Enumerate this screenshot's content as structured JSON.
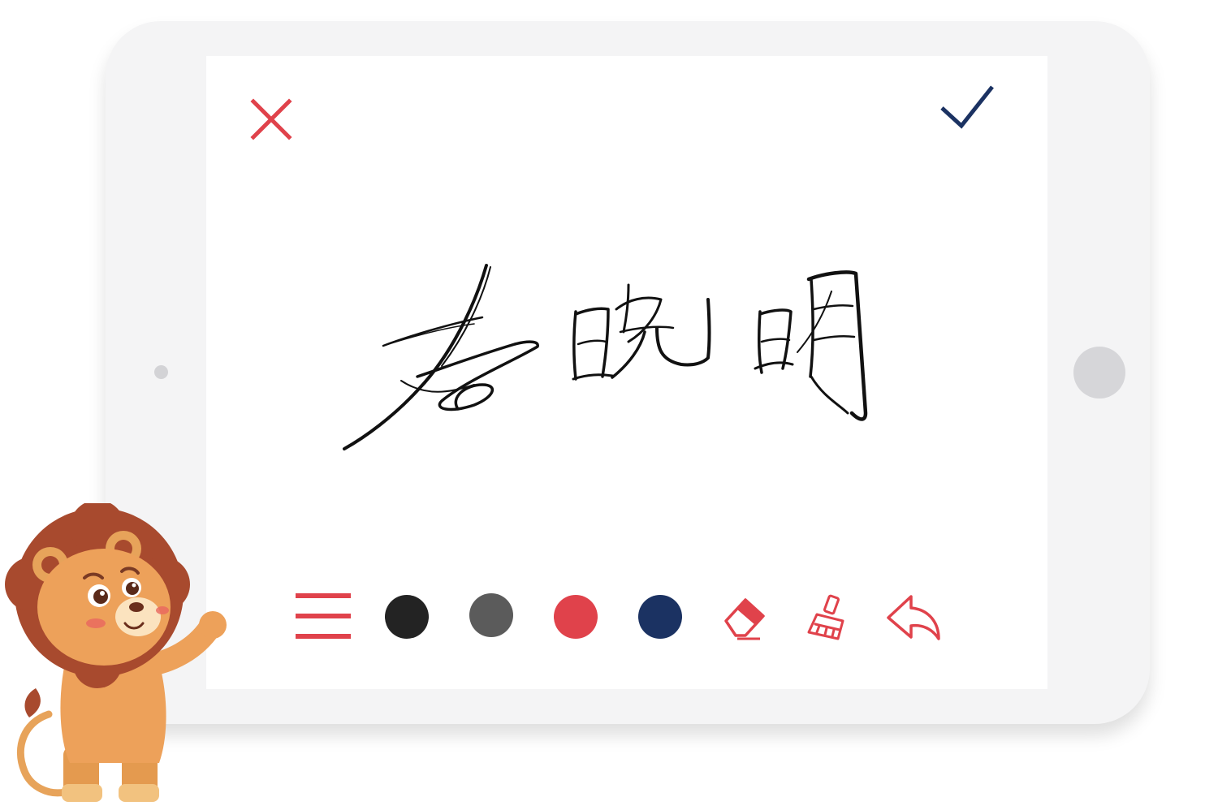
{
  "screen": {
    "cancel_icon": "close-icon",
    "confirm_icon": "check-icon",
    "cancel_color": "#e0424b",
    "confirm_color": "#1b3262"
  },
  "signature": {
    "ink_color": "#111111",
    "icon": "handwritten-signature"
  },
  "toolbar": {
    "menu_icon": "menu-icon",
    "colors": [
      {
        "name": "black",
        "hex": "#232323"
      },
      {
        "name": "gray",
        "hex": "#5b5b5b"
      },
      {
        "name": "red",
        "hex": "#e0424b"
      },
      {
        "name": "navy",
        "hex": "#1b3262"
      }
    ],
    "tools": [
      "eraser-icon",
      "broom-icon",
      "undo-icon"
    ],
    "accent": "#e0424b"
  },
  "decoration": {
    "mascot": "lion-mascot"
  }
}
